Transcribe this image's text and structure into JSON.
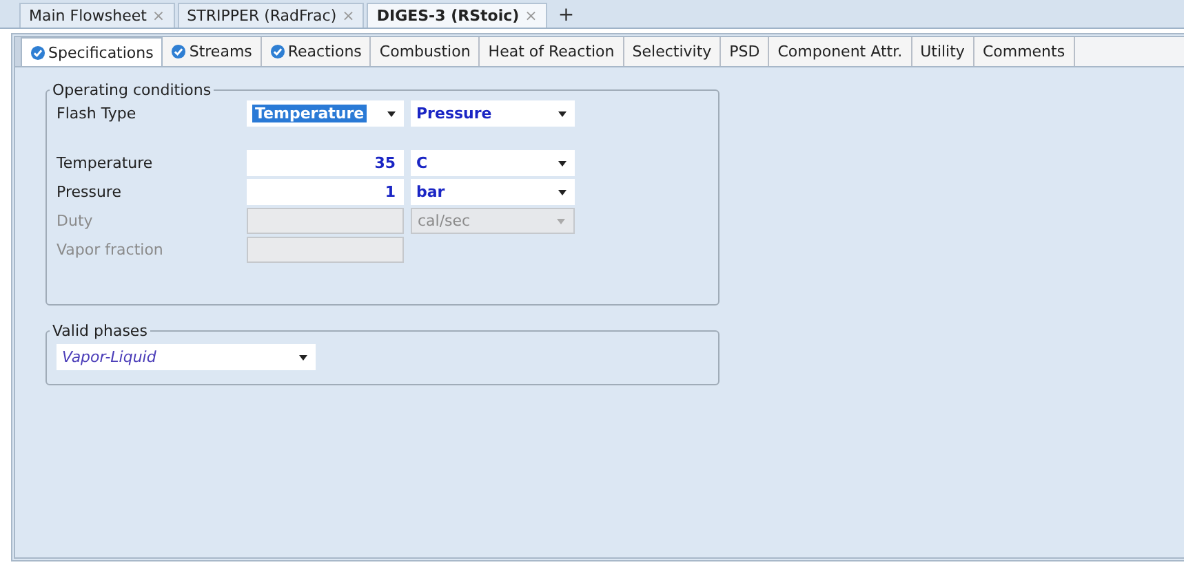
{
  "doc_tabs": [
    {
      "label": "Main Flowsheet",
      "selected": false
    },
    {
      "label": "STRIPPER (RadFrac)",
      "selected": false
    },
    {
      "label": "DIGES-3 (RStoic)",
      "selected": true
    }
  ],
  "add_tab": "+",
  "close_glyph": "×",
  "tabs": [
    {
      "label": "Specifications",
      "selected": true,
      "complete": true
    },
    {
      "label": "Streams",
      "selected": false,
      "complete": true
    },
    {
      "label": "Reactions",
      "selected": false,
      "complete": true
    },
    {
      "label": "Combustion",
      "selected": false,
      "complete": false
    },
    {
      "label": "Heat of Reaction",
      "selected": false,
      "complete": false
    },
    {
      "label": "Selectivity",
      "selected": false,
      "complete": false
    },
    {
      "label": "PSD",
      "selected": false,
      "complete": false
    },
    {
      "label": "Component Attr.",
      "selected": false,
      "complete": false
    },
    {
      "label": "Utility",
      "selected": false,
      "complete": false
    },
    {
      "label": "Comments",
      "selected": false,
      "complete": false
    }
  ],
  "operating_conditions": {
    "title": "Operating conditions",
    "flash_type": {
      "label": "Flash Type",
      "options": [
        {
          "value": "Temperature",
          "highlighted": true
        },
        {
          "value": "Pressure",
          "highlighted": false
        }
      ]
    },
    "rows": [
      {
        "label": "Temperature",
        "disabled": false,
        "value": "35",
        "unit": "C"
      },
      {
        "label": "Pressure",
        "disabled": false,
        "value": "1",
        "unit": "bar"
      },
      {
        "label": "Duty",
        "disabled": true,
        "unit": "cal/sec"
      },
      {
        "label": "Vapor fraction",
        "disabled": true
      }
    ]
  },
  "valid_phases": {
    "title": "Valid phases",
    "value": "Vapor-Liquid"
  }
}
